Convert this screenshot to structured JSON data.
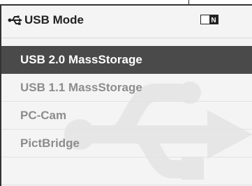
{
  "header": {
    "title": "USB Mode",
    "usb_icon": "usb-symbol-icon",
    "badge_icon": "mode-indicator-icon",
    "badge_text": "N"
  },
  "menu": {
    "items": [
      {
        "label": "USB 2.0 MassStorage",
        "selected": true
      },
      {
        "label": "USB 1.1 MassStorage",
        "selected": false
      },
      {
        "label": "PC-Cam",
        "selected": false
      },
      {
        "label": "PictBridge",
        "selected": false
      }
    ]
  },
  "colors": {
    "selected_bg": "#4a4a4a",
    "selected_text": "#ffffff",
    "item_text": "#8c8c8c",
    "background": "#f4f4f4"
  }
}
